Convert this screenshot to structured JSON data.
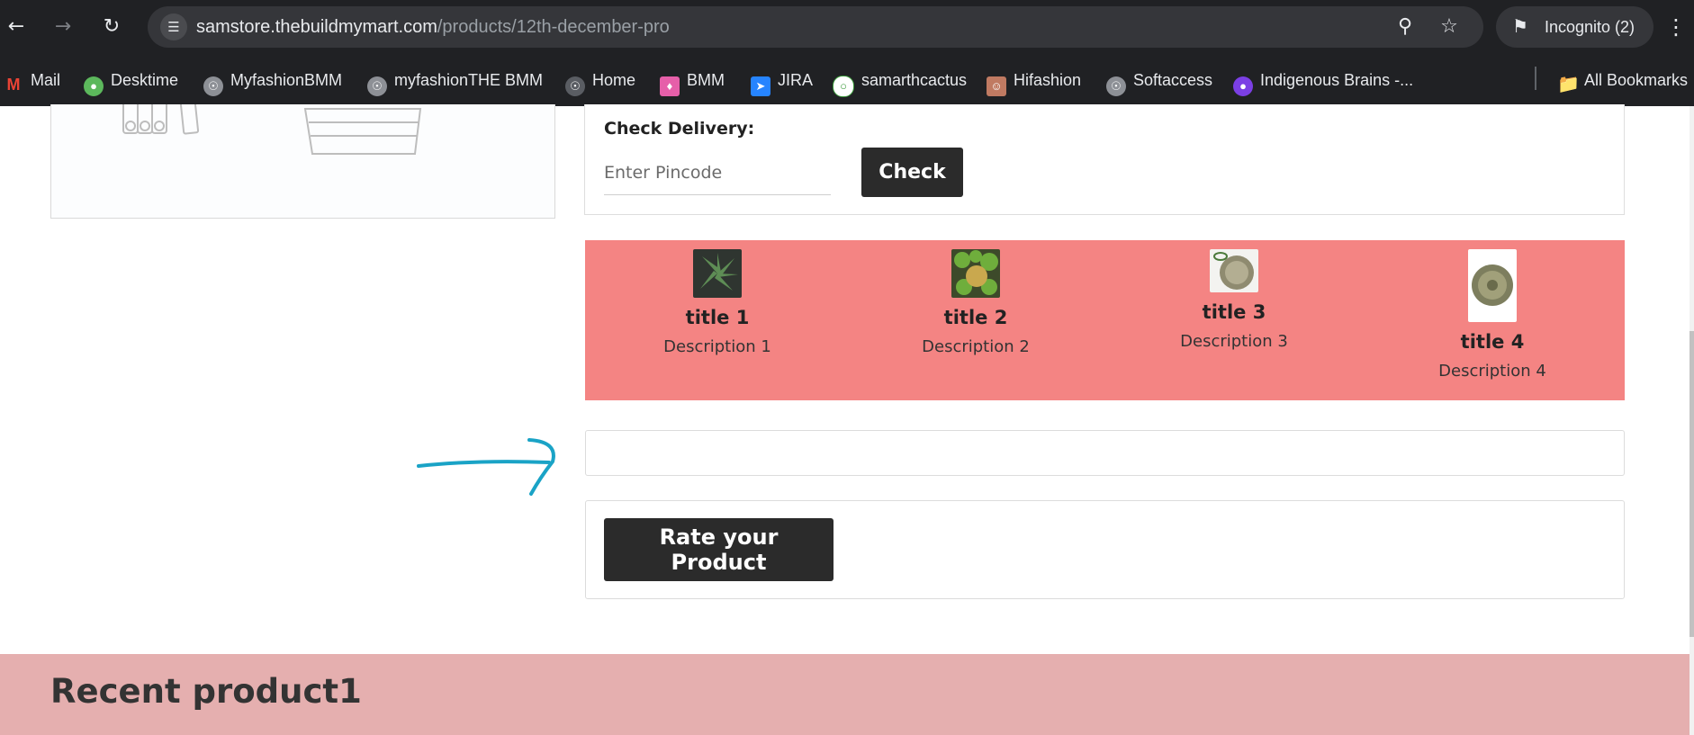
{
  "browser": {
    "url_host": "samstore.thebuildmymart.com",
    "url_path": "/products/12th-december-pro",
    "incognito_label": "Incognito (2)"
  },
  "bookmarks": [
    {
      "label": "Mail",
      "icon": "gmail-icon",
      "color": "#ea4335"
    },
    {
      "label": "Desktime",
      "icon": "desktime-icon",
      "color": "#5cb85c"
    },
    {
      "label": "MyfashionBMM",
      "icon": "globe-icon",
      "color": "#8d9096"
    },
    {
      "label": "myfashionTHE BMM",
      "icon": "globe-icon",
      "color": "#8d9096"
    },
    {
      "label": "Home",
      "icon": "globe-icon",
      "color": "#5a5d63"
    },
    {
      "label": "BMM",
      "icon": "bmm-icon",
      "color": "#e65fa9"
    },
    {
      "label": "JIRA",
      "icon": "jira-icon",
      "color": "#2684ff"
    },
    {
      "label": "samarthcactus",
      "icon": "samarthcactus-icon",
      "color": "#3a9b3a"
    },
    {
      "label": "Hifashion",
      "icon": "hifashion-icon",
      "color": "#c07a62"
    },
    {
      "label": "Softaccess",
      "icon": "globe-icon",
      "color": "#8d9096"
    },
    {
      "label": "Indigenous Brains -...",
      "icon": "indigenous-icon",
      "color": "#7b3fe4"
    }
  ],
  "all_bookmarks_label": "All Bookmarks",
  "delivery": {
    "label": "Check Delivery:",
    "placeholder": "Enter Pincode",
    "button": "Check"
  },
  "features": [
    {
      "title": "title 1",
      "description": "Description 1"
    },
    {
      "title": "title 2",
      "description": "Description 2"
    },
    {
      "title": "title 3",
      "description": "Description 3"
    },
    {
      "title": "title 4",
      "description": "Description 4"
    }
  ],
  "rate_button": "Rate your Product",
  "recent_title": "Recent product1",
  "colors": {
    "feature_band": "#f48483",
    "recent_band": "#e5afaf",
    "button_dark": "#2b2b2b",
    "annotation_arrow": "#1aa3c6"
  }
}
